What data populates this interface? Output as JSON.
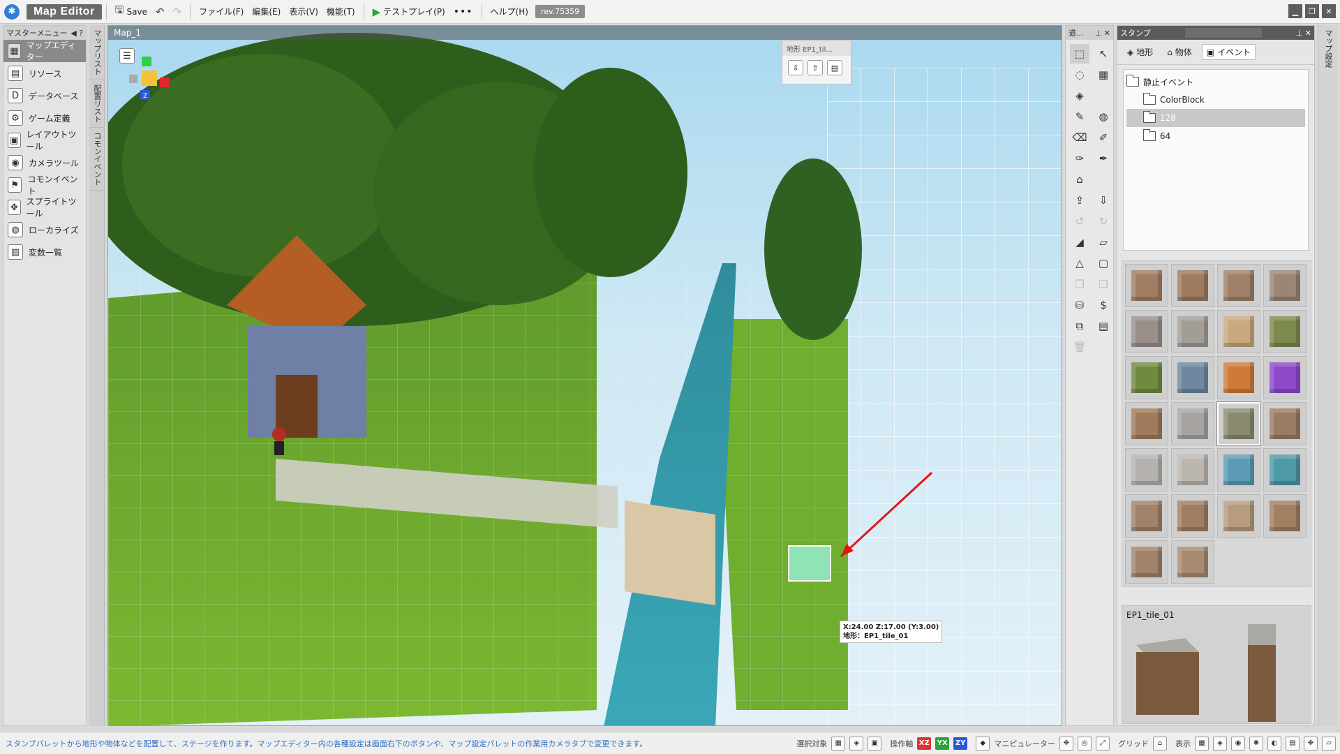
{
  "app": {
    "title": "Map Editor",
    "revision": "rev.75359"
  },
  "toolbar": {
    "save_label": "Save",
    "menus": [
      "ファイル(F)",
      "編集(E)",
      "表示(V)",
      "機能(T)"
    ],
    "testplay_label": "テストプレイ(P)",
    "more_label": "•••",
    "help_label": "ヘルプ(H)"
  },
  "master_menu": {
    "title": "マスターメニュー",
    "help": "?",
    "items": [
      {
        "label": "マップエディター",
        "icon": "map-icon",
        "active": true
      },
      {
        "label": "リソース",
        "icon": "resource-icon"
      },
      {
        "label": "データベース",
        "icon": "database-icon"
      },
      {
        "label": "ゲーム定義",
        "icon": "game-definition-icon"
      },
      {
        "label": "レイアウトツール",
        "icon": "layout-icon"
      },
      {
        "label": "カメラツール",
        "icon": "camera-icon"
      },
      {
        "label": "コモンイベント",
        "icon": "common-event-icon"
      },
      {
        "label": "スプライトツール",
        "icon": "sprite-icon"
      },
      {
        "label": "ローカライズ",
        "icon": "localize-icon"
      },
      {
        "label": "変数一覧",
        "icon": "variables-icon"
      }
    ]
  },
  "side_tabs": [
    "マップリスト",
    "配置リスト",
    "コモンイベント"
  ],
  "viewport": {
    "tab_label": "Map_1",
    "float_palette_title": "地形 EP1_til...",
    "coord_line1": "X:24.00 Z:17.00 (Y:3.00)",
    "coord_line2": "地形：EP1_tile_01",
    "axis_z_label": "Z"
  },
  "tool_panel": {
    "title": "道..."
  },
  "stamp_panel": {
    "title": "スタンプ",
    "tabs": [
      {
        "label": "地形",
        "icon": "terrain-icon"
      },
      {
        "label": "物体",
        "icon": "object-icon"
      },
      {
        "label": "イベント",
        "icon": "event-icon",
        "active": true
      }
    ],
    "tree": {
      "root": "静止イベント",
      "children": [
        "ColorBlock",
        "128",
        "64"
      ],
      "selected": "128"
    },
    "tiles": [
      "#a07e63",
      "#9e7b5e",
      "#a08066",
      "#9a8676",
      "#9a8f8b",
      "#a39d97",
      "#c9aa7e",
      "#7d8a4e",
      "#6f8b40",
      "#6f88a0",
      "#d07a3a",
      "#8e49c9",
      "#a07b5c",
      "#a7a3a0",
      "#8b8a6f",
      "#9a7c66",
      "#b5b1ae",
      "#bcb6b0",
      "#5c9bb5",
      "#4e9aa6",
      "#a0826a",
      "#a07e62",
      "#b89c7f",
      "#a37f62",
      "#a3826a",
      "#a98a70"
    ],
    "selected_tile_index": 14,
    "preview_name": "EP1_tile_01"
  },
  "right_tab": "マップ設定",
  "status": {
    "message": "スタンプパレットから地形や物体などを配置して、ステージを作ります。マップエディター内の各種設定は画面右下のボタンや、マップ設定パレットの作業用カメラタブで変更できます。",
    "select_target_label": "選択対象",
    "operation_axis_label": "操作軸",
    "axes": [
      "XZ",
      "YX",
      "ZY"
    ],
    "manipulator_label": "マニピュレーター",
    "grid_label": "グリッド",
    "display_label": "表示"
  }
}
